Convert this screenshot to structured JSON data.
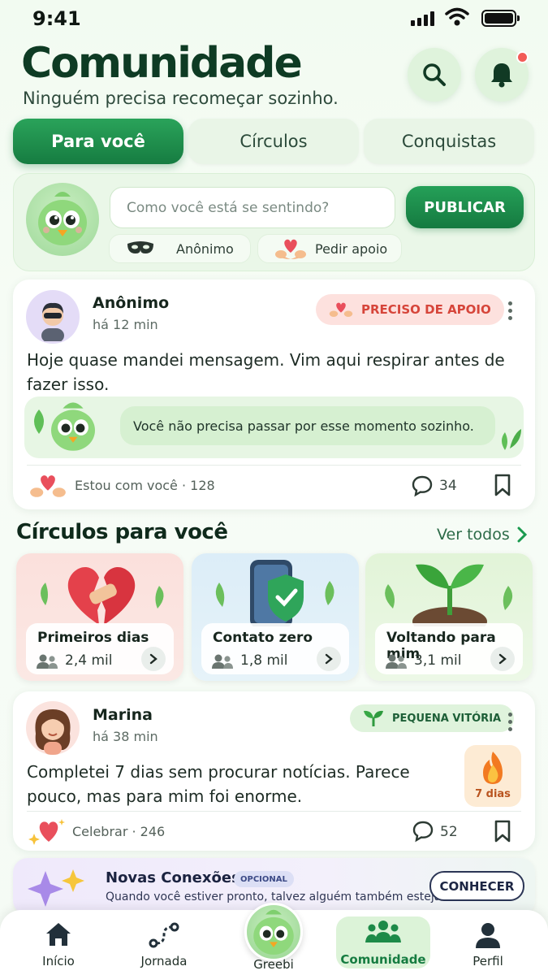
{
  "status_bar": {
    "time": "9:41"
  },
  "header": {
    "title": "Comunidade",
    "subtitle": "Ninguém precisa recomeçar sozinho."
  },
  "tabs": [
    {
      "label": "Para você",
      "active": true
    },
    {
      "label": "Círculos",
      "active": false
    },
    {
      "label": "Conquistas",
      "active": false
    }
  ],
  "composer": {
    "placeholder": "Como você está se sentindo?",
    "publish_label": "PUBLICAR",
    "anonymous_label": "Anônimo",
    "support_label": "Pedir apoio"
  },
  "post1": {
    "author": "Anônimo",
    "time": "há 12 min",
    "badge": "PRECISO DE APOIO",
    "text": "Hoje quase mandei mensagem. Vim aqui respirar antes de fazer isso.",
    "greebi_reply": "Você não precisa passar por esse momento sozinho.",
    "reaction_label": "Estou com você · 128",
    "comments": "34"
  },
  "circles": {
    "title": "Círculos para você",
    "see_all": "Ver todos",
    "items": [
      {
        "name": "Primeiros dias",
        "members": "2,4 mil"
      },
      {
        "name": "Contato zero",
        "members": "1,8 mil"
      },
      {
        "name": "Voltando para mim",
        "members": "3,1 mil"
      }
    ]
  },
  "post2": {
    "author": "Marina",
    "time": "há 38 min",
    "badge": "PEQUENA VITÓRIA",
    "text": "Completei 7 dias sem procurar notícias. Parece pouco, mas para mim foi enorme.",
    "streak": "7 dias",
    "reaction_label": "Celebrar · 246",
    "comments": "52"
  },
  "novas": {
    "title": "Novas Conexões",
    "tag": "OPCIONAL",
    "subtitle": "Quando você estiver pronto, talvez alguém também esteja.",
    "button": "CONHECER"
  },
  "nav": [
    {
      "label": "Início"
    },
    {
      "label": "Jornada"
    },
    {
      "label": "Greebi"
    },
    {
      "label": "Comunidade",
      "active": true
    },
    {
      "label": "Perfil"
    }
  ],
  "colors": {
    "primary": "#167c41",
    "support_badge": "#fde1de",
    "victory_badge": "#dff3dc"
  }
}
